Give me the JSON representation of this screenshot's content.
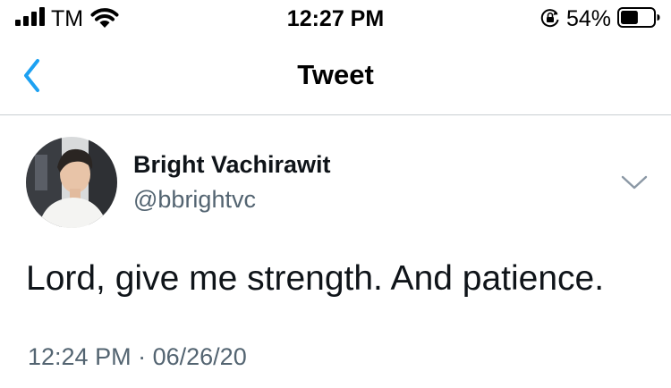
{
  "status_bar": {
    "carrier": "TM",
    "time": "12:27 PM",
    "battery_percent": "54%",
    "battery_level": 0.54,
    "signal_icon": "cellular-signal-icon",
    "wifi_icon": "wifi-icon",
    "lock_icon": "rotation-lock-icon",
    "battery_icon": "battery-icon"
  },
  "nav": {
    "title": "Tweet",
    "back_icon": "chevron-left-icon",
    "accent_color": "#1da1f2"
  },
  "tweet": {
    "author": {
      "display_name": "Bright Vachirawit",
      "handle": "@bbrightvc",
      "avatar": "profile-photo"
    },
    "text": "Lord, give me strength. And patience.",
    "time": "12:24 PM",
    "separator": "·",
    "date": "06/26/20",
    "more_icon": "chevron-down-icon"
  }
}
